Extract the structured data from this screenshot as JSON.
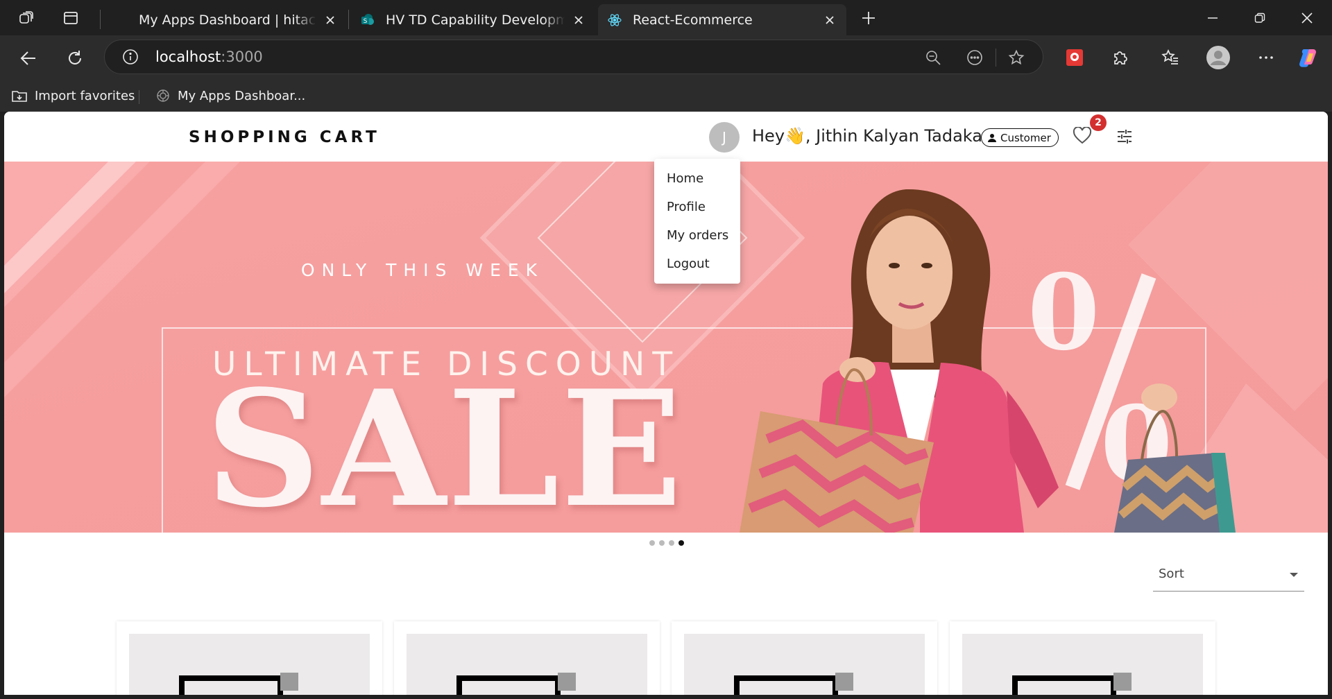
{
  "browser": {
    "tabs": [
      {
        "title": "My Apps Dashboard | hitachivantara",
        "active": false
      },
      {
        "title": "HV TD Capability Development (LMS)",
        "active": false
      },
      {
        "title": "React-Ecommerce",
        "active": true
      }
    ],
    "url_host": "localhost",
    "url_port": ":3000",
    "favorites": [
      {
        "label": "Import favorites"
      },
      {
        "label": "My Apps Dashboar..."
      }
    ]
  },
  "header": {
    "brand": "SHOPPING CART",
    "avatar_letter": "J",
    "greeting": "Hey👋, Jithin Kalyan Tadaka",
    "role": "Customer",
    "wishlist_count": "2"
  },
  "user_menu": {
    "items": [
      "Home",
      "Profile",
      "My orders",
      "Logout"
    ]
  },
  "banner": {
    "tagline": "ONLY THIS WEEK",
    "headline": "ULTIMATE DISCOUNT",
    "big_word": "SALE",
    "slides": 4,
    "active_slide": 4
  },
  "sort": {
    "label": "Sort"
  },
  "colors": {
    "banner_bg": "#f9a3a3",
    "badge": "#d32f2f",
    "jacket": "#e8537a"
  }
}
